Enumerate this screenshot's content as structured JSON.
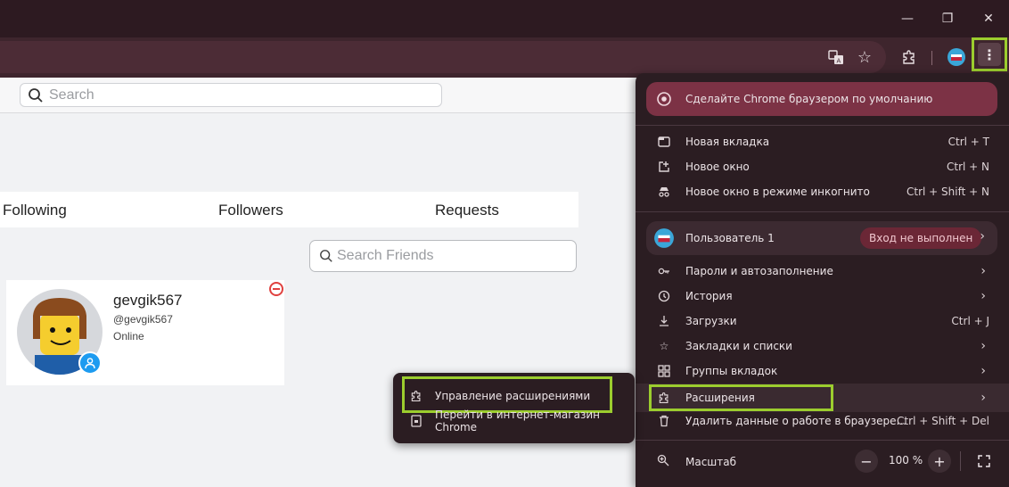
{
  "window": {
    "minimize_glyph": "—",
    "restore_glyph": "❐",
    "close_glyph": "✕"
  },
  "toolbar": {
    "icons": [
      "translate-icon",
      "star-icon",
      "extensions-icon",
      "profile-avatar",
      "menu-dots-icon"
    ],
    "menu_glyph": "⋮"
  },
  "page": {
    "search_placeholder": "Search",
    "tabs": [
      "Following",
      "Followers",
      "Requests"
    ],
    "friends_search_placeholder": "Search Friends",
    "friend": {
      "name": "gevgik567",
      "handle": "@gevgik567",
      "status": "Online"
    }
  },
  "menu": {
    "default_banner": "Сделайте Chrome браузером по умолчанию",
    "new_tab": {
      "label": "Новая вкладка",
      "shortcut": "Ctrl + T"
    },
    "new_window": {
      "label": "Новое окно",
      "shortcut": "Ctrl + N"
    },
    "incognito": {
      "label": "Новое окно в режиме инкогнито",
      "shortcut": "Ctrl + Shift + N"
    },
    "profile": {
      "label": "Пользователь 1",
      "badge": "Вход не выполнен"
    },
    "passwords": {
      "label": "Пароли и автозаполнение"
    },
    "history": {
      "label": "История"
    },
    "downloads": {
      "label": "Загрузки",
      "shortcut": "Ctrl + J"
    },
    "bookmarks": {
      "label": "Закладки и списки"
    },
    "tab_groups": {
      "label": "Группы вкладок"
    },
    "extensions": {
      "label": "Расширения"
    },
    "clear_data": {
      "label": "Удалить данные о работе в браузере...",
      "shortcut": "Ctrl + Shift + Del"
    },
    "zoom": {
      "label": "Масштаб",
      "value": "100 %",
      "minus": "−",
      "plus": "+"
    },
    "chevron": "›"
  },
  "submenu": {
    "manage": "Управление расширениями",
    "store": "Перейти в интернет-магазин Chrome"
  },
  "colors": {
    "highlight": "#9ccd2e",
    "menu_bg": "#2b1d22",
    "banner": "#7c3245"
  }
}
